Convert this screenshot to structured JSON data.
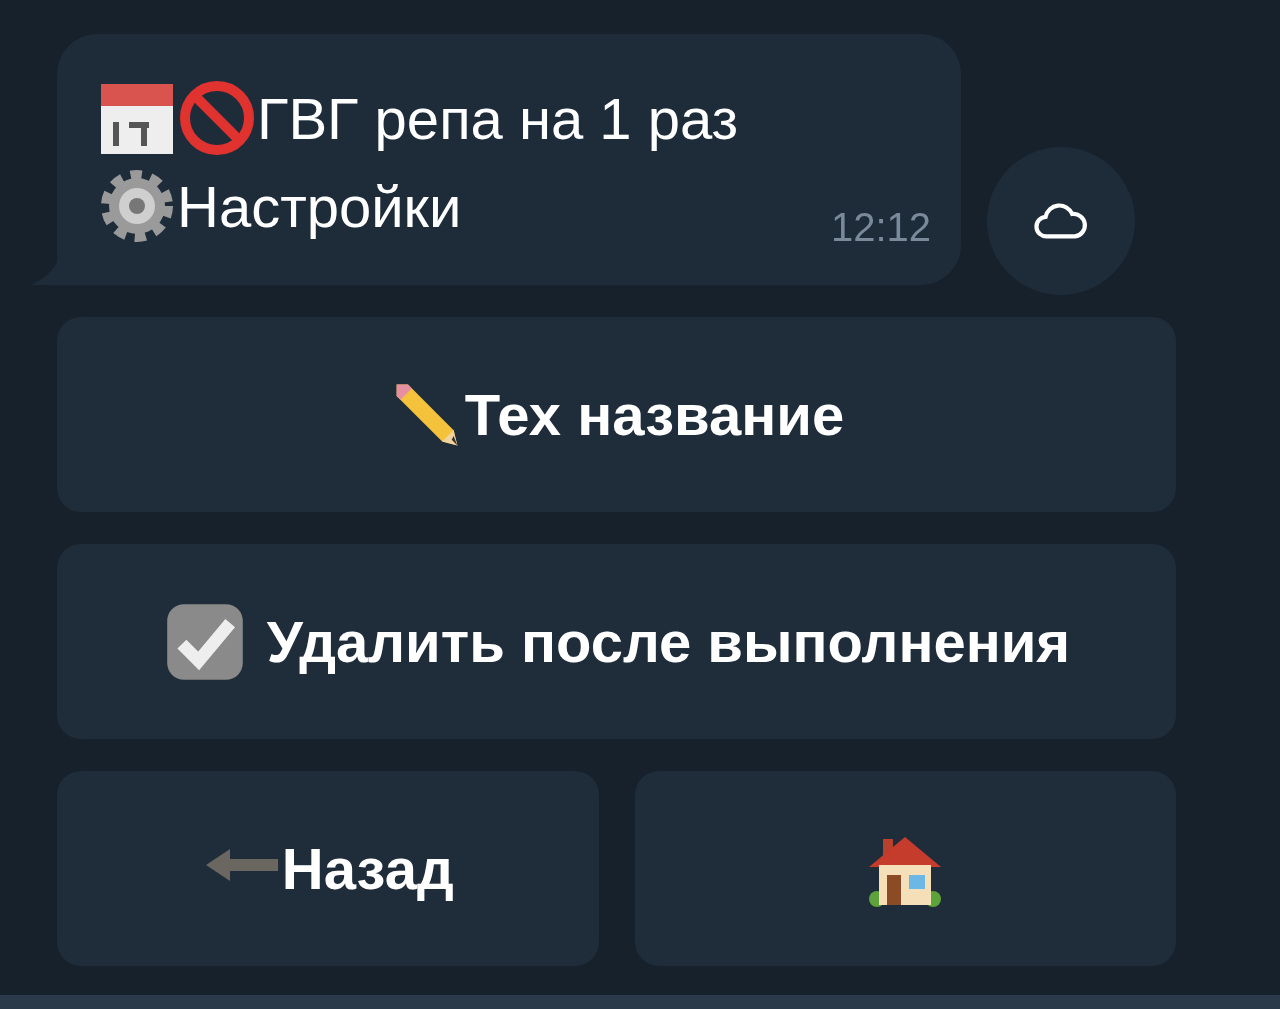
{
  "message": {
    "lines": [
      "ГВГ репа на 1 раз",
      "Настройки"
    ],
    "time": "12:12"
  },
  "keyboard": [
    [
      {
        "kind": "labeled",
        "label": "Тех название"
      }
    ],
    [
      {
        "kind": "labeled",
        "label": "Удалить после выполнения"
      }
    ],
    [
      {
        "kind": "labeled",
        "label": "Назад"
      },
      {
        "kind": "icon_only"
      }
    ]
  ]
}
